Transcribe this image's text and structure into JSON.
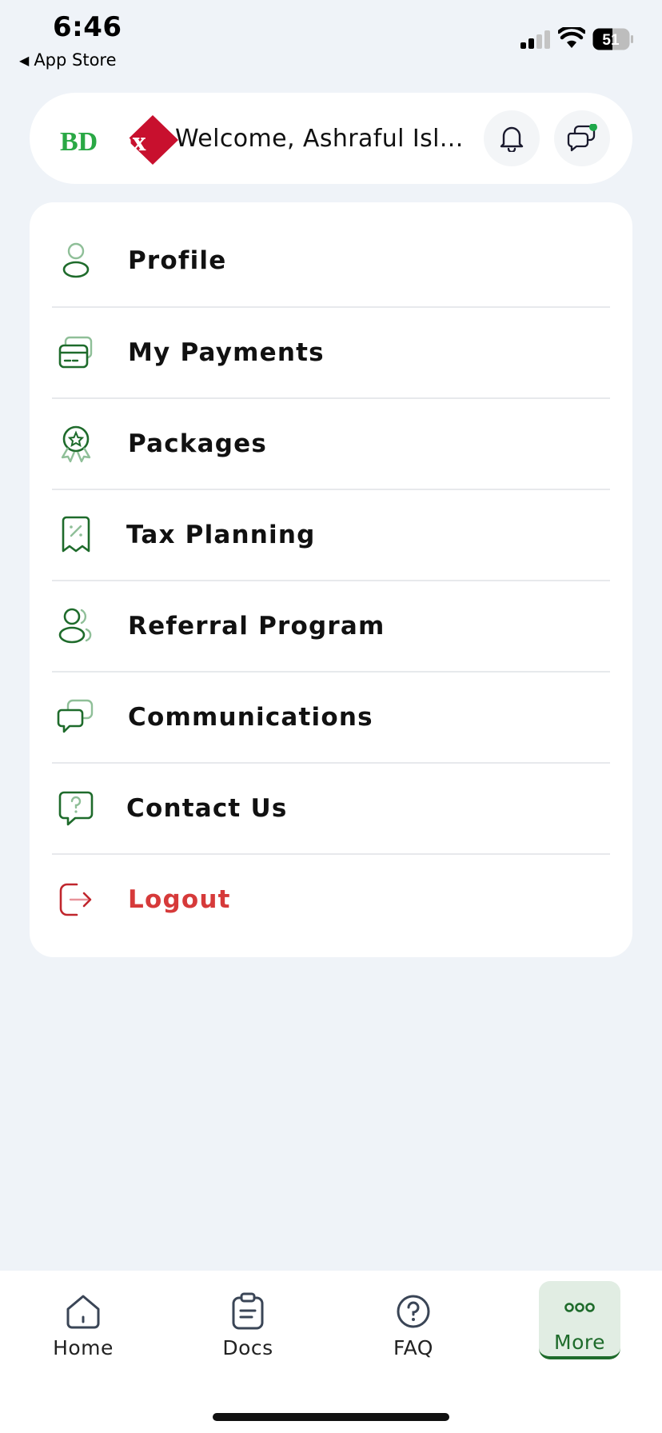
{
  "status_bar": {
    "time": "6:46",
    "back_label": "App Store",
    "battery": "51"
  },
  "header": {
    "logo_text_bd": "BD",
    "logo_text_tax": "Tax",
    "welcome": "Welcome, Ashraful Isl..."
  },
  "menu": {
    "items": [
      {
        "label": "Profile",
        "icon": "user-icon"
      },
      {
        "label": "My Payments",
        "icon": "card-icon"
      },
      {
        "label": "Packages",
        "icon": "badge-icon"
      },
      {
        "label": "Tax Planning",
        "icon": "receipt-percent-icon"
      },
      {
        "label": "Referral Program",
        "icon": "users-icon"
      },
      {
        "label": "Communications",
        "icon": "chat-icon"
      },
      {
        "label": "Contact Us",
        "icon": "help-chat-icon"
      },
      {
        "label": "Logout",
        "icon": "logout-icon"
      }
    ]
  },
  "nav": {
    "items": [
      {
        "label": "Home",
        "icon": "home-icon"
      },
      {
        "label": "Docs",
        "icon": "clipboard-icon"
      },
      {
        "label": "FAQ",
        "icon": "question-icon"
      },
      {
        "label": "More",
        "icon": "more-icon",
        "active": true
      }
    ]
  },
  "colors": {
    "accent": "#1e6b2b",
    "danger": "#d63a3a",
    "background": "#eff3f8"
  }
}
